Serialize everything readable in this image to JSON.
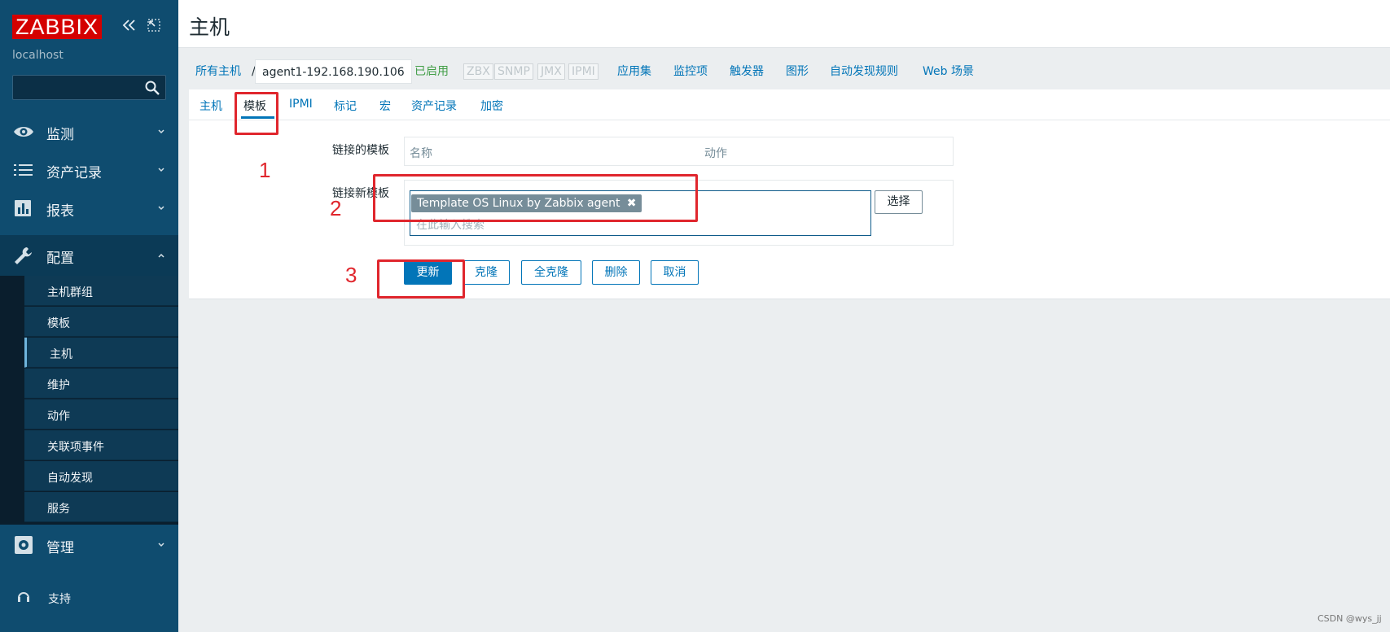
{
  "app": {
    "brand": "ZABBIX",
    "server_name": "localhost"
  },
  "sidebar": {
    "menu": [
      {
        "label": "监测",
        "icon": "eye-icon"
      },
      {
        "label": "资产记录",
        "icon": "list-icon"
      },
      {
        "label": "报表",
        "icon": "bar-chart-icon"
      },
      {
        "label": "配置",
        "icon": "wrench-icon"
      },
      {
        "label": "管理",
        "icon": "gear-icon"
      }
    ],
    "config_submenu": [
      "主机群组",
      "模板",
      "主机",
      "维护",
      "动作",
      "关联项事件",
      "自动发现",
      "服务"
    ],
    "support_label": "支持"
  },
  "header": {
    "title": "主机"
  },
  "nav": {
    "all_hosts": "所有主机",
    "separator": "/",
    "current_host": "agent1-192.168.190.106",
    "status": "已启用",
    "availability": [
      "ZBX",
      "SNMP",
      "JMX",
      "IPMI"
    ],
    "links": [
      "应用集",
      "监控项",
      "触发器",
      "图形",
      "自动发现规则",
      "Web 场景"
    ]
  },
  "tabs": [
    "主机",
    "模板",
    "IPMI",
    "标记",
    "宏",
    "资产记录",
    "加密"
  ],
  "active_tab": "模板",
  "form": {
    "linked_templates_label": "链接的模板",
    "linked_table_headers": {
      "name": "名称",
      "action": "动作"
    },
    "link_new_label": "链接新模板",
    "selected_template": "Template OS Linux by Zabbix agent",
    "search_placeholder": "在此输入搜索",
    "select_button": "选择"
  },
  "buttons": {
    "update": "更新",
    "clone": "克隆",
    "full_clone": "全克隆",
    "delete": "删除",
    "cancel": "取消"
  },
  "annotations": [
    "1",
    "2",
    "3"
  ],
  "watermark": "CSDN @wys_jj",
  "colors": {
    "sidebar": "#0f4c6f",
    "brand": "#d40000",
    "link": "#0275b8",
    "enabled": "#429e47",
    "annotation": "#e0262d"
  }
}
